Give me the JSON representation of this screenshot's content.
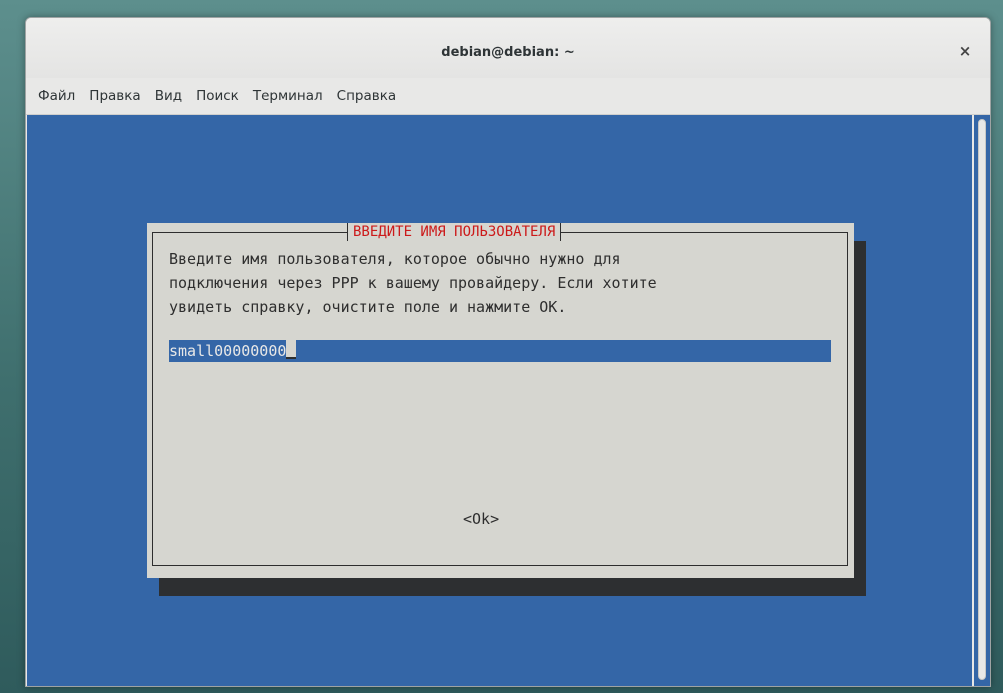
{
  "window": {
    "title": "debian@debian: ~",
    "close_glyph": "×"
  },
  "menubar": {
    "items": [
      "Файл",
      "Правка",
      "Вид",
      "Поиск",
      "Терминал",
      "Справка"
    ]
  },
  "dialog": {
    "title": "ВВЕДИТЕ ИМЯ ПОЛЬЗОВАТЕЛЯ",
    "text_lines": [
      "Введите имя пользователя, которое обычно нужно для",
      "подключения через PPP к вашему провайдеру. Если хотите",
      "увидеть справку, очистите поле и нажмите OK."
    ],
    "input_value": "small00000000",
    "ok_label": "<Ok>"
  },
  "colors": {
    "terminal_background": "#3466a7",
    "dialog_background": "#d6d6d0",
    "dialog_title": "#cc1a1a",
    "shadow": "#2d2f31"
  },
  "icons": {
    "close": "close-icon"
  }
}
